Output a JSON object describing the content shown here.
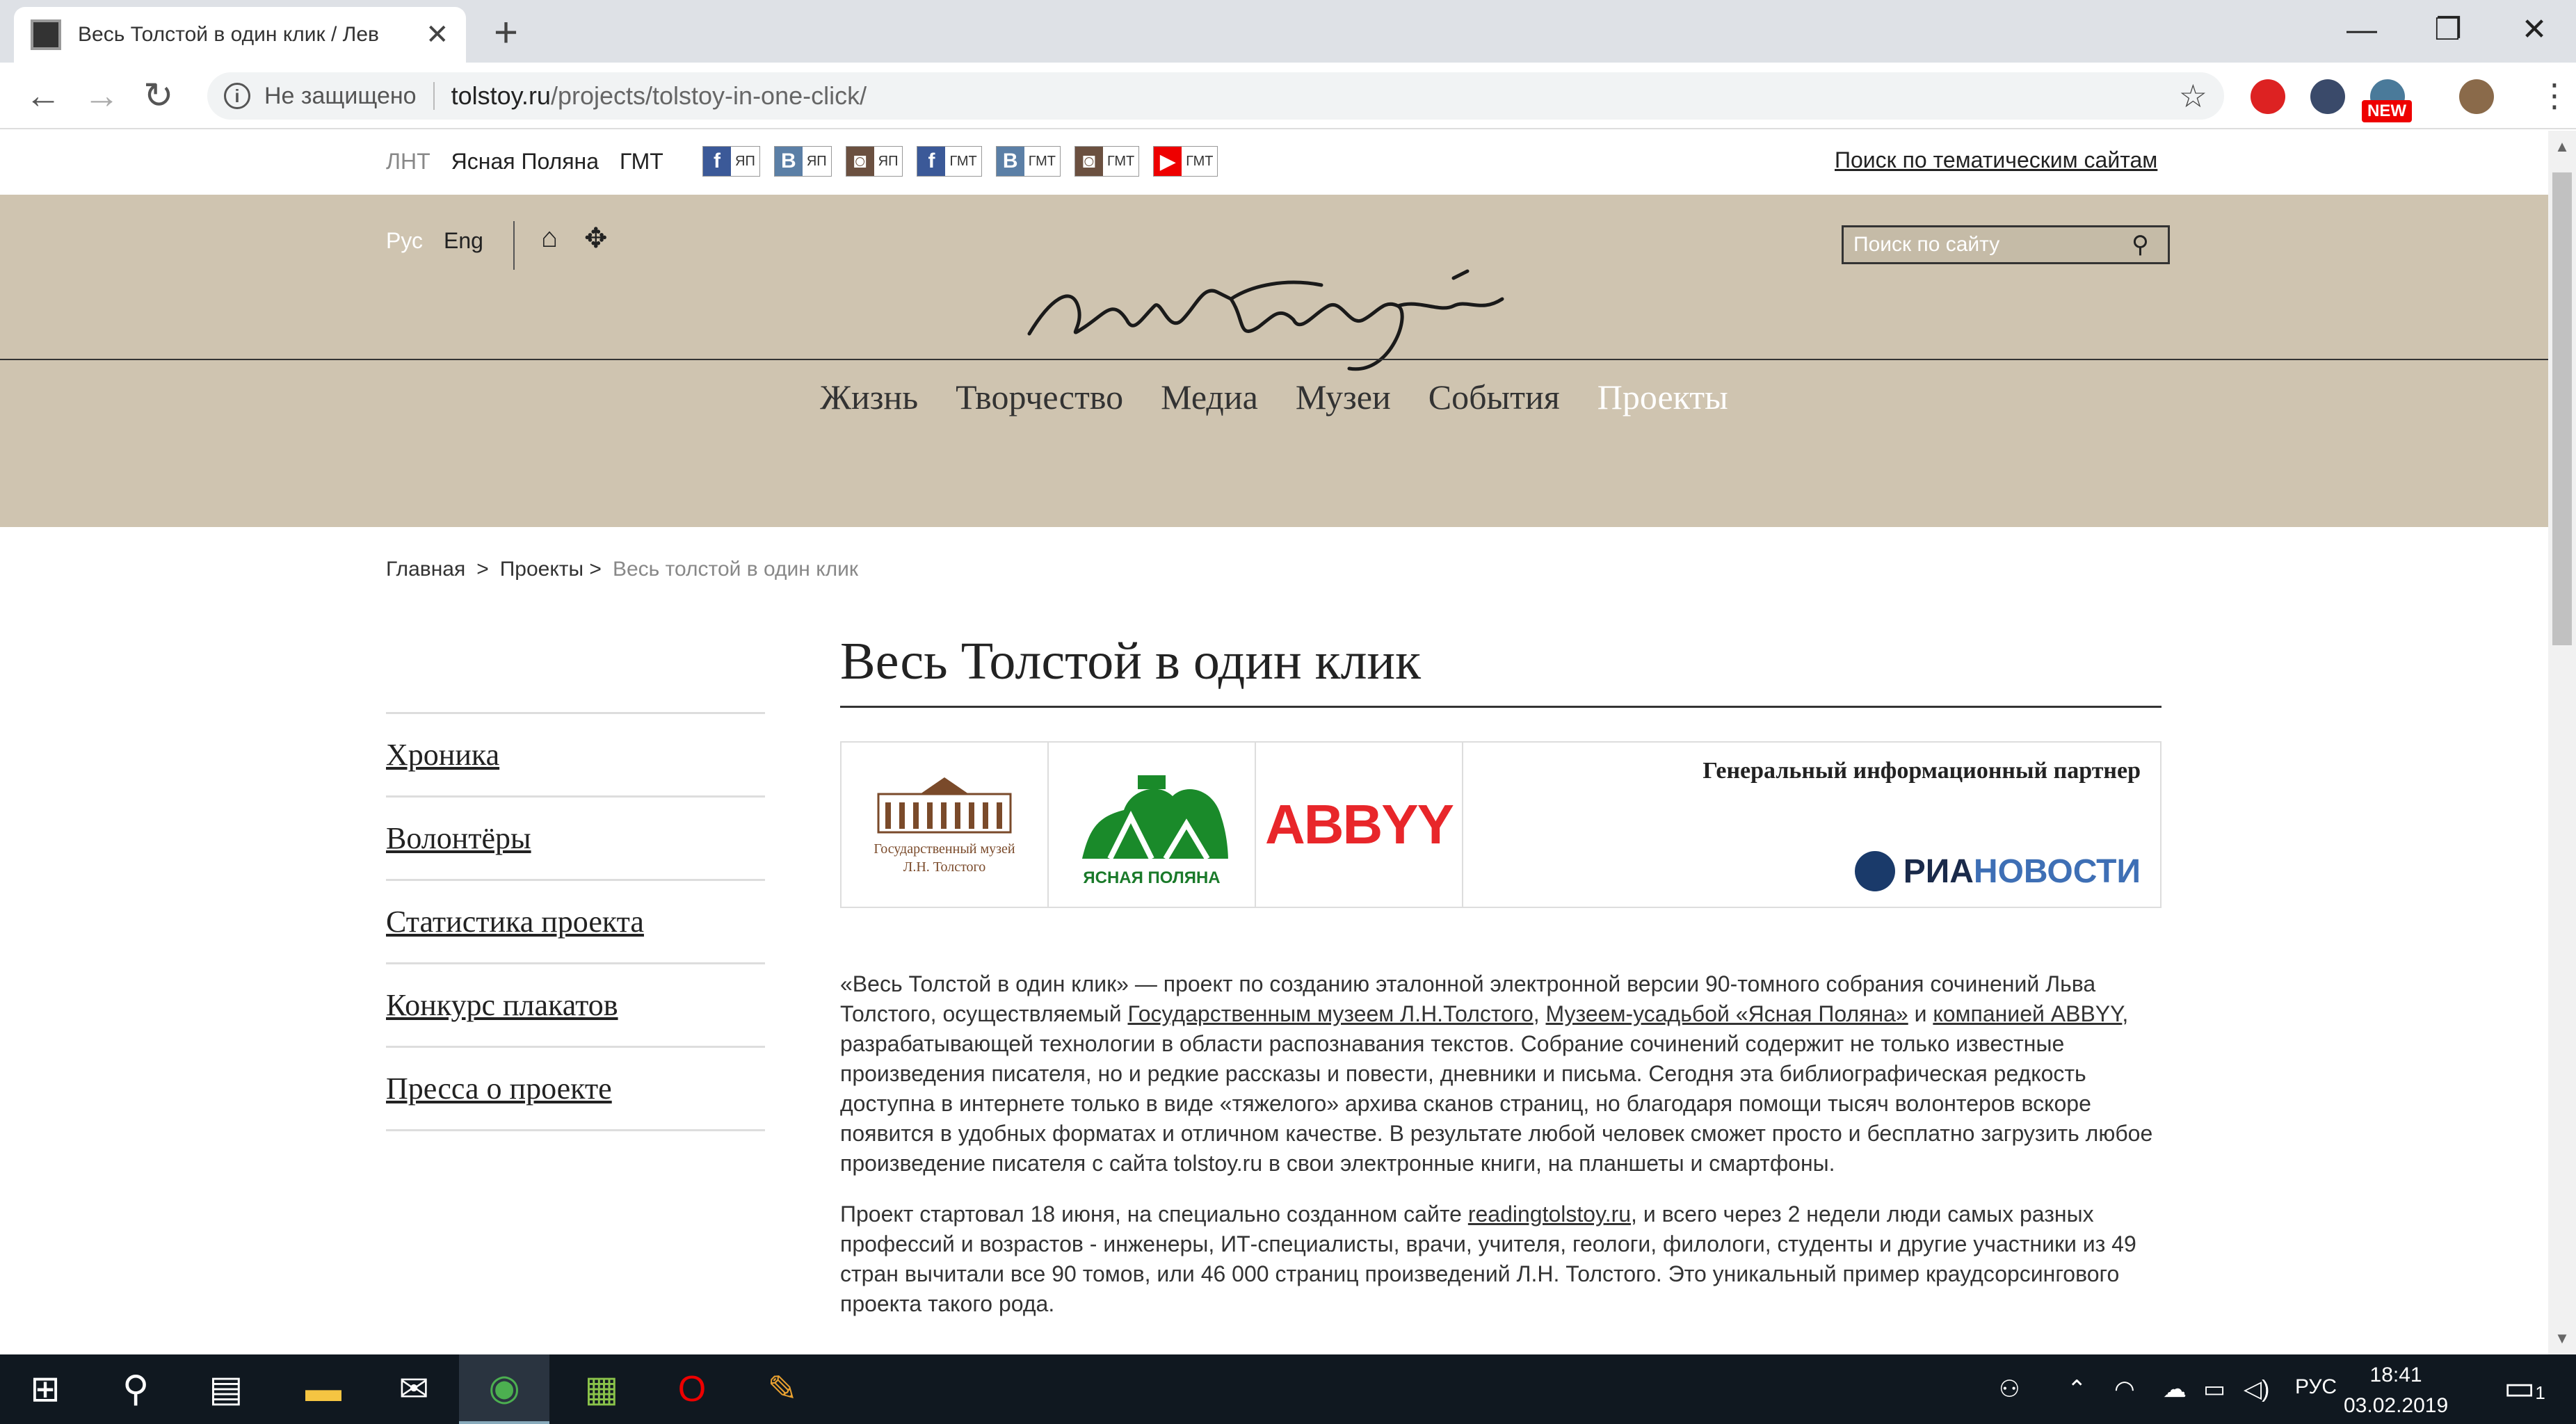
{
  "browser": {
    "tab_title": "Весь Толстой в один клик / Лев",
    "tab_close": "✕",
    "new_tab": "+",
    "security_label": "Не защищено",
    "url_host": "tolstoy.ru",
    "url_path": "/projects/tolstoy-in-one-click/",
    "new_badge": "NEW",
    "window_controls": {
      "minimize": "—",
      "restore": "❐",
      "close": "✕"
    }
  },
  "top_strip": {
    "links": [
      "ЛНТ",
      "Ясная Поляна",
      "ГМТ"
    ],
    "social": [
      {
        "icon": "facebook-icon",
        "glyph": "f",
        "label": "ЯП",
        "kind": "fb"
      },
      {
        "icon": "vk-icon",
        "glyph": "B",
        "label": "ЯП",
        "kind": "vk"
      },
      {
        "icon": "instagram-icon",
        "glyph": "◙",
        "label": "ЯП",
        "kind": "ig"
      },
      {
        "icon": "facebook-icon",
        "glyph": "f",
        "label": "ГМТ",
        "kind": "fb"
      },
      {
        "icon": "vk-icon",
        "glyph": "B",
        "label": "ГМТ",
        "kind": "vk"
      },
      {
        "icon": "instagram-icon",
        "glyph": "◙",
        "label": "ГМТ",
        "kind": "ig"
      },
      {
        "icon": "youtube-icon",
        "glyph": "▶",
        "label": "ГМТ",
        "kind": "yt"
      }
    ],
    "theme_search": "Поиск по тематическим сайтам"
  },
  "header": {
    "lang_ru": "Рус",
    "lang_en": "Eng",
    "search_placeholder": "Поиск по сайту",
    "bg_color": "#cfc4b0"
  },
  "main_nav": [
    "Жизнь",
    "Творчество",
    "Медиа",
    "Музеи",
    "События",
    "Проекты"
  ],
  "breadcrumb": {
    "home": "Главная",
    "sep": ">",
    "section": "Проекты >",
    "current": "Весь толстой в один клик"
  },
  "sidebar": [
    "Хроника",
    "Волонтёры",
    "Статистика проекта",
    "Конкурс плакатов",
    "Пресса о проекте"
  ],
  "main": {
    "title": "Весь Толстой в один клик",
    "partners": {
      "gmt_caption_1": "Государственный музей",
      "gmt_caption_2": "Л.Н. Толстого",
      "yp_caption": "ЯСНАЯ ПОЛЯНА",
      "abbyy": "ABBYY",
      "general_partner": "Генеральный информационный партнер",
      "ria_1": "РИА",
      "ria_2": "НОВОСТИ"
    },
    "p1": {
      "t1": "«Весь Толстой в один клик» — проект по созданию эталонной электронной версии 90-томного собрания сочинений Льва Толстого, осуществляемый ",
      "a1": "Государственным музеем Л.Н.Толстого",
      "t2": ", ",
      "a2": "Музеем-усадьбой «Ясная Поляна»",
      "t3": " и ",
      "a3": "компанией ABBYY",
      "t4": ", разрабатывающей технологии в области распознавания текстов. Собрание сочинений содержит не только известные произведения писателя, но и редкие рассказы и повести, дневники и письма. Сегодня эта библиографическая редкость доступна в интернете только в виде «тяжелого» архива сканов страниц, но благодаря помощи тысяч волонтеров вскоре появится в удобных форматах и отличном качестве. В результате любой человек сможет просто и бесплатно загрузить любое произведение писателя с сайта tolstoy.ru в свои электронные книги, на планшеты и смартфоны."
    },
    "p2": {
      "t1": "Проект стартовал 18 июня, на специально созданном сайте ",
      "a1": "readingtolstoy.ru",
      "t2": ", и всего через 2 недели люди самых разных профессий и возрастов - инженеры, ИТ-специалисты, врачи, учителя, геологи, филологи, студенты и другие участники из 49 стран вычитали все 90 томов, или 46 000 страниц произведений Л.Н. Толстого. Это уникальный пример краудсорсингового проекта такого рода."
    }
  },
  "taskbar": {
    "lang": "РУС",
    "time": "18:41",
    "date": "03.02.2019",
    "notif_count": "1"
  }
}
